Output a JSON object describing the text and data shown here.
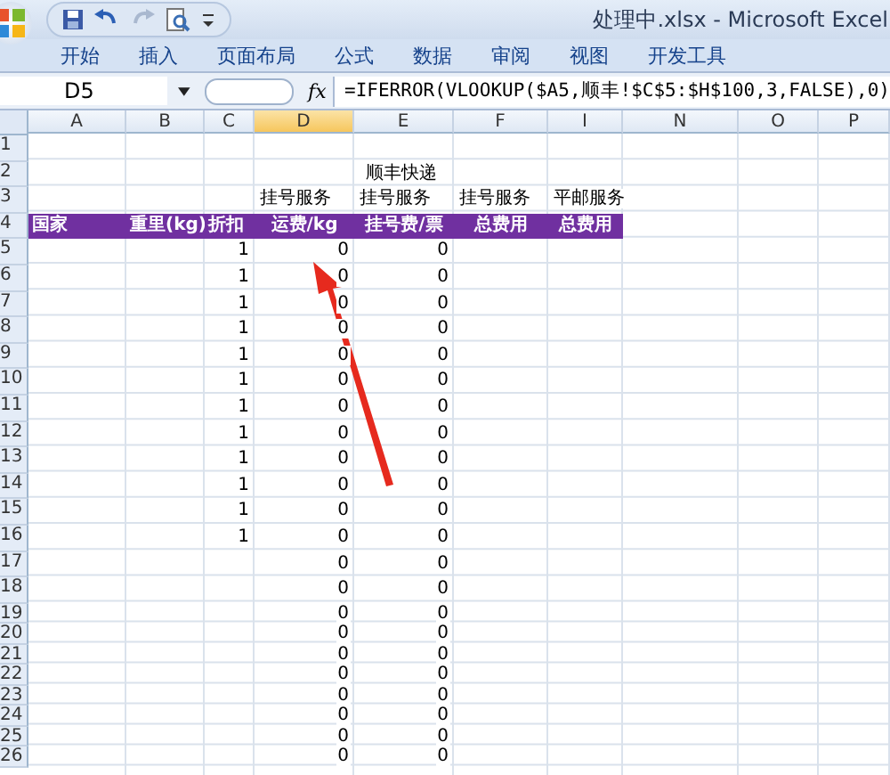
{
  "window": {
    "title": "处理中.xlsx - Microsoft Excel"
  },
  "ribbon_tabs": [
    {
      "label": "开始"
    },
    {
      "label": "插入"
    },
    {
      "label": "页面布局"
    },
    {
      "label": "公式"
    },
    {
      "label": "数据"
    },
    {
      "label": "审阅"
    },
    {
      "label": "视图"
    },
    {
      "label": "开发工具"
    }
  ],
  "formula_bar": {
    "name_box": "D5",
    "fx": "fx",
    "formula": "=IFERROR(VLOOKUP($A5,顺丰!$C$5:$H$100,3,FALSE),0)"
  },
  "columns": [
    "A",
    "B",
    "C",
    "D",
    "E",
    "F",
    "I",
    "N",
    "O",
    "P"
  ],
  "rows": [
    {
      "number": "1",
      "kind": "normal",
      "cells": {}
    },
    {
      "number": "2",
      "kind": "title",
      "cells": {
        "D": "顺丰快递"
      }
    },
    {
      "number": "3",
      "kind": "normal",
      "cells": {
        "D": "挂号服务",
        "E": "挂号服务",
        "F": "挂号服务",
        "I": "平邮服务"
      }
    },
    {
      "number": "4",
      "kind": "header",
      "cells": {
        "A": "国家",
        "B": "重里(kg)",
        "C": "折扣",
        "D": "运费/kg",
        "E": "挂号费/票",
        "F": "总费用",
        "I": "总费用"
      }
    },
    {
      "number": "5",
      "kind": "normal",
      "cells": {
        "C": "1",
        "D": "0",
        "E": "0"
      }
    },
    {
      "number": "6",
      "kind": "normal",
      "cells": {
        "C": "1",
        "D": "0",
        "E": "0"
      }
    },
    {
      "number": "7",
      "kind": "normal",
      "cells": {
        "C": "1",
        "D": "0",
        "E": "0"
      }
    },
    {
      "number": "8",
      "kind": "normal",
      "cells": {
        "C": "1",
        "D": "0",
        "E": "0"
      }
    },
    {
      "number": "9",
      "kind": "normal",
      "cells": {
        "C": "1",
        "D": "0",
        "E": "0"
      }
    },
    {
      "number": "10",
      "kind": "normal",
      "cells": {
        "C": "1",
        "D": "0",
        "E": "0"
      }
    },
    {
      "number": "11",
      "kind": "normal",
      "cells": {
        "C": "1",
        "D": "0",
        "E": "0"
      }
    },
    {
      "number": "12",
      "kind": "normal",
      "cells": {
        "C": "1",
        "D": "0",
        "E": "0"
      }
    },
    {
      "number": "13",
      "kind": "normal",
      "cells": {
        "C": "1",
        "D": "0",
        "E": "0"
      }
    },
    {
      "number": "14",
      "kind": "normal",
      "cells": {
        "C": "1",
        "D": "0",
        "E": "0"
      }
    },
    {
      "number": "15",
      "kind": "normal",
      "cells": {
        "C": "1",
        "D": "0",
        "E": "0"
      }
    },
    {
      "number": "16",
      "kind": "normal",
      "cells": {
        "C": "1",
        "D": "0",
        "E": "0"
      }
    },
    {
      "number": "17",
      "kind": "normal",
      "cells": {
        "D": "0",
        "E": "0"
      }
    },
    {
      "number": "18",
      "kind": "normal",
      "cells": {
        "D": "0",
        "E": "0"
      }
    },
    {
      "number": "19",
      "kind": "small",
      "cells": {
        "D": "0",
        "E": "0"
      }
    },
    {
      "number": "20",
      "kind": "small",
      "cells": {
        "D": "0",
        "E": "0"
      }
    },
    {
      "number": "21",
      "kind": "small",
      "cells": {
        "D": "0",
        "E": "0"
      }
    },
    {
      "number": "22",
      "kind": "small",
      "cells": {
        "D": "0",
        "E": "0"
      }
    },
    {
      "number": "23",
      "kind": "small",
      "cells": {
        "D": "0",
        "E": "0"
      }
    },
    {
      "number": "24",
      "kind": "small",
      "cells": {
        "D": "0",
        "E": "0"
      }
    },
    {
      "number": "25",
      "kind": "small",
      "cells": {
        "D": "0",
        "E": "0"
      }
    },
    {
      "number": "26",
      "kind": "small",
      "cells": {
        "D": "0",
        "E": "0"
      }
    }
  ]
}
